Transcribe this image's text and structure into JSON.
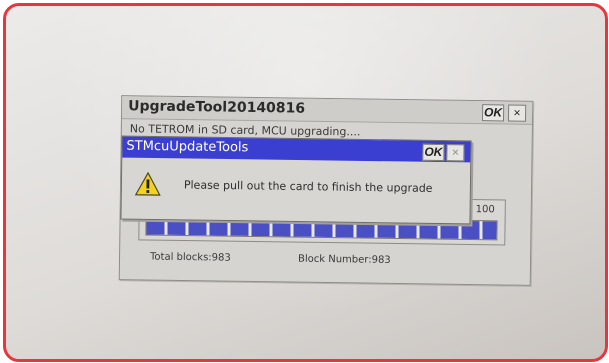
{
  "colors": {
    "photo_border": "#e8363f",
    "dialog_titlebar": "#3b3fd1",
    "progress_fill": "#4b4fc4",
    "window_background": "#d6d4d1"
  },
  "upgrade_window": {
    "title": "UpgradeTool20140816",
    "ok_label": "OK",
    "close_label": "×",
    "status": "No TETROM in SD card, MCU upgrading....",
    "progress": {
      "max_label": "100",
      "percent": 100
    },
    "total_blocks": "Total blocks:983",
    "block_number": "Block Number:983"
  },
  "dialog": {
    "title": "STMcuUpdateTools",
    "ok_label": "OK",
    "close_label": "×",
    "icon": "warning-icon",
    "message": "Please pull out the card to finish the upgrade"
  }
}
